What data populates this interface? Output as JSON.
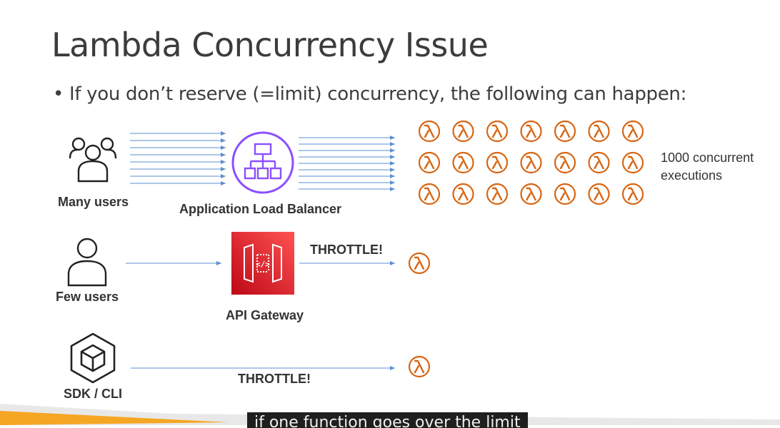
{
  "slide": {
    "title": "Lambda Concurrency Issue",
    "bullet": "• If you don’t reserve (=limit) concurrency, the following can happen:"
  },
  "rows": {
    "many": {
      "source_label": "Many users",
      "via_label": "Application Load Balancer",
      "result_label_line1": "1000 concurrent",
      "result_label_line2": "executions"
    },
    "few": {
      "source_label": "Few users",
      "via_label": "API Gateway",
      "throttle_label": "THROTTLE!"
    },
    "sdk": {
      "source_label": "SDK / CLI",
      "throttle_label": "THROTTLE!"
    }
  },
  "icons": {
    "users_group": "users-group-icon",
    "user_single": "user-icon",
    "alb": "application-load-balancer-icon",
    "api_gateway": "api-gateway-icon",
    "sdk_cli": "sdk-cli-cube-icon",
    "lambda": "lambda-icon"
  },
  "colors": {
    "lambda_orange": "#d86613",
    "alb_purple": "#8c4fff",
    "api_gateway_red": "#e7157b",
    "arrow_blue": "#5b8fd1",
    "footer_orange": "#f5a623"
  },
  "caption": "if one function goes over the limit"
}
